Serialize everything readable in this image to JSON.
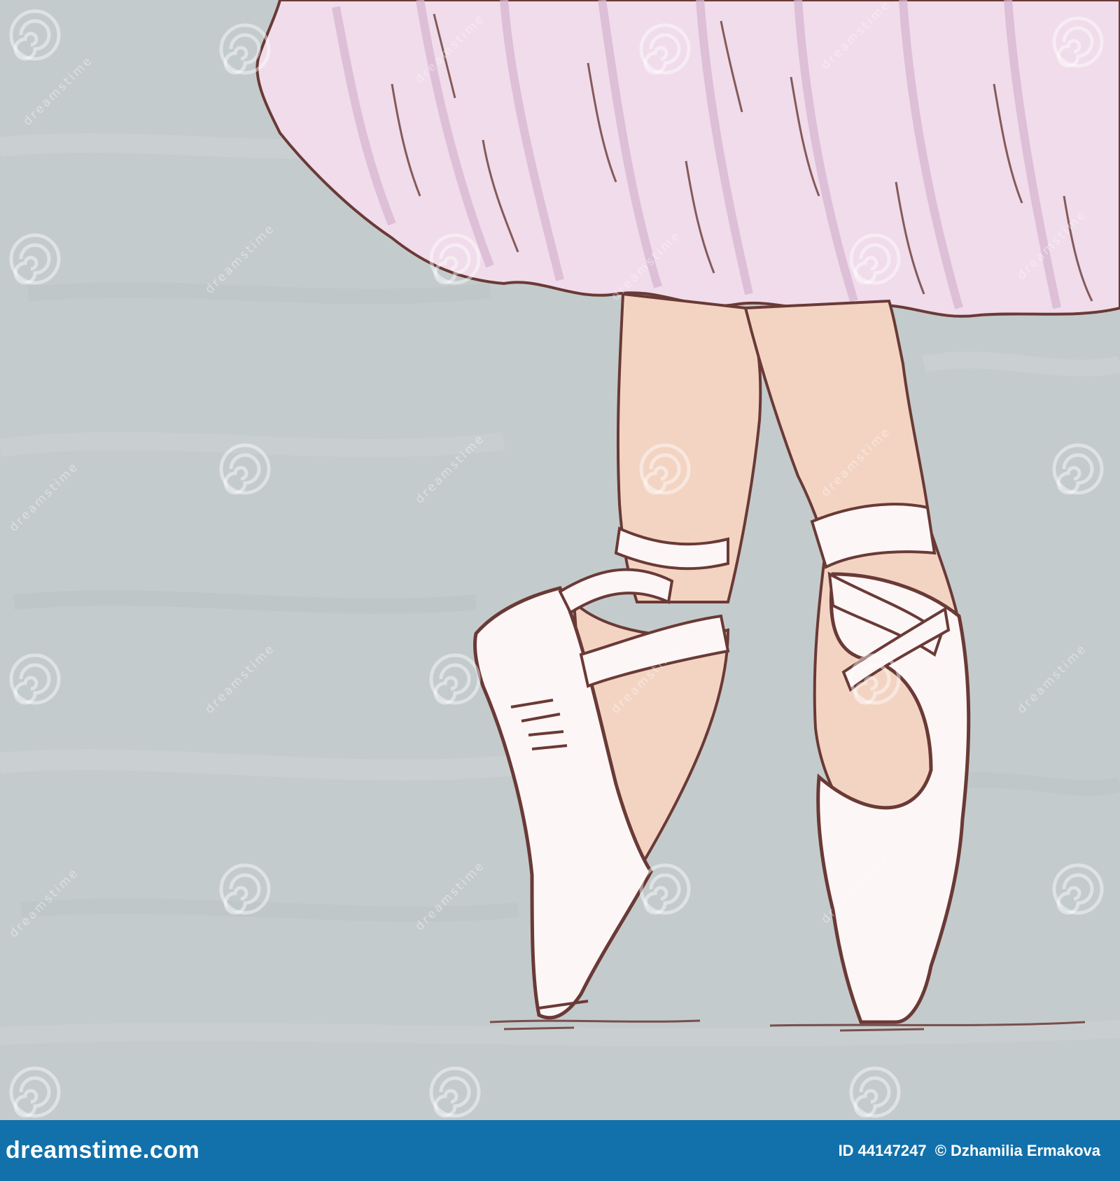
{
  "colors": {
    "background": "#c4cbcc",
    "skirt": "#f0dcea",
    "skirt_stripe": "#d7b6d2",
    "skin": "#f3d4c3",
    "shoe": "#fdf6f6",
    "ink": "#6a3a36",
    "footer": "#1271aa"
  },
  "watermark": {
    "text": "dreamstime",
    "icon": "spiral-icon"
  },
  "footer": {
    "logo_text": "dreamstime.com",
    "id_text": "ID 44147247",
    "credit_text": "© Dzhamilia Ermakova"
  }
}
